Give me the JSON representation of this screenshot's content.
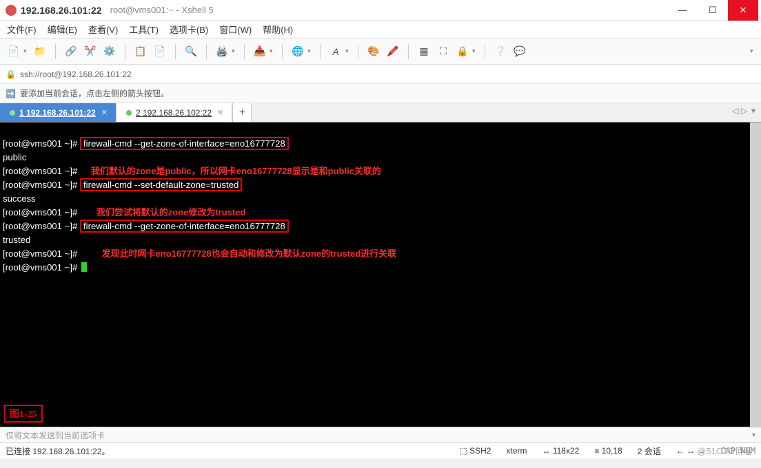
{
  "titlebar": {
    "main": "192.168.26.101:22",
    "sub": "root@vms001:~ - Xshell 5"
  },
  "menu": {
    "file": "文件(F)",
    "edit": "编辑(E)",
    "view": "查看(V)",
    "tools": "工具(T)",
    "tabs": "选项卡(B)",
    "window": "窗口(W)",
    "help": "帮助(H)"
  },
  "address": {
    "url": "ssh://root@192.168.26.101:22"
  },
  "hint": {
    "text": "要添加当前会话，点击左侧的箭头按钮。"
  },
  "tabs": {
    "items": [
      {
        "index": "1",
        "label": "192.168.26.101:22",
        "active": true
      },
      {
        "index": "2",
        "label": "192.168.26.102:22",
        "active": false
      }
    ]
  },
  "terminal": {
    "prompt": "[root@vms001 ~]# ",
    "lines": [
      {
        "prompt": "[root@vms001 ~]# ",
        "cmd": "firewall-cmd --get-zone-of-interface=eno16777728",
        "boxed": true
      },
      {
        "out": "public"
      },
      {
        "prompt": "[root@vms001 ~]# ",
        "ann": "我们默认的zone是public，所以网卡eno16777728显示是和public关联的"
      },
      {
        "prompt": "[root@vms001 ~]# ",
        "cmd": "firewall-cmd --set-default-zone=trusted",
        "boxed": true
      },
      {
        "out": "success"
      },
      {
        "prompt": "[root@vms001 ~]# ",
        "ann": "我们尝试将默认的zone修改为trusted"
      },
      {
        "prompt": "[root@vms001 ~]# ",
        "cmd": "firewall-cmd --get-zone-of-interface=eno16777728",
        "boxed": true
      },
      {
        "out": "trusted"
      },
      {
        "prompt": "[root@vms001 ~]# ",
        "ann": "发现此时网卡eno16777728也会自动和修改为默认zone的trusted进行关联"
      },
      {
        "prompt": "[root@vms001 ~]# ",
        "cursor": true
      }
    ],
    "figure_label": "图1-25"
  },
  "inputbar": {
    "placeholder": "仅将文本发送到当前选项卡"
  },
  "status": {
    "conn": "已连接 192.168.26.101:22。",
    "proto_icon": "⬚",
    "proto": "SSH2",
    "term": "xterm",
    "size_icon": "↔",
    "size": "118x22",
    "cursor_icon": "≡",
    "cursor": "10,18",
    "sess_count": "2",
    "sess_label": "会话",
    "sess_nav": "← ↔ →",
    "caps": "CAP   NUM"
  },
  "watermark": "@51CTO博客"
}
